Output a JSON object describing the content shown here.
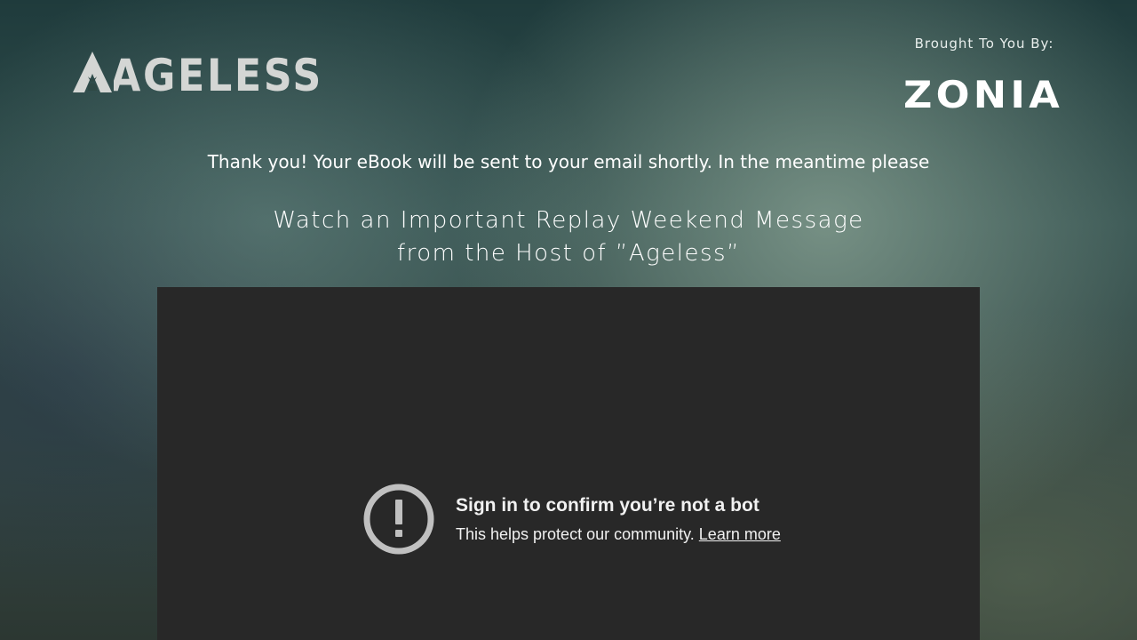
{
  "header": {
    "logo_text": "AGELESS",
    "brought_to_you_by": "Brought To You By:",
    "sponsor_logo_text": "ZONIA"
  },
  "main": {
    "thank_you": "Thank you! Your eBook will be sent to your email shortly. In the meantime please",
    "headline_line1": "Watch an Important Replay Weekend Message",
    "headline_line2": "from the Host of ”Ageless”"
  },
  "video": {
    "notice_title": "Sign in to confirm you’re not a bot",
    "notice_subtitle": "This helps protect our community.",
    "learn_more_label": "Learn more",
    "icon": "alert-circle-icon",
    "background_color": "#282828"
  },
  "colors": {
    "logo": "#d4d6d4",
    "text": "#ffffff",
    "notice_text": "#f1f1f1",
    "icon": "#c0c0c0"
  }
}
